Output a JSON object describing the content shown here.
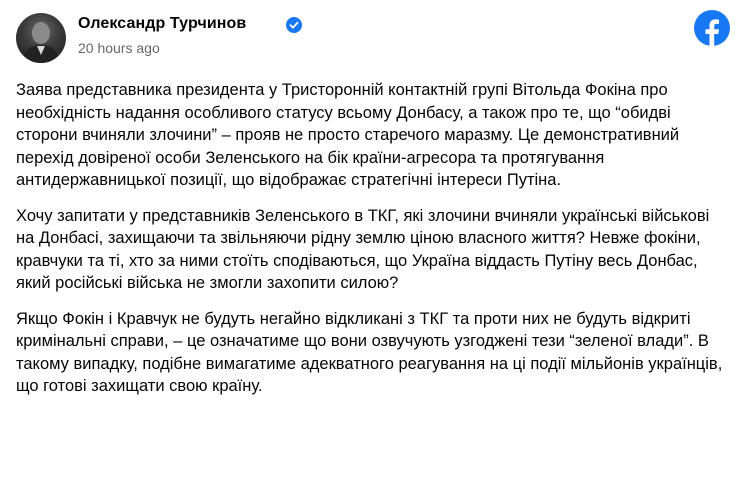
{
  "post": {
    "author": "Олександр Турчинов",
    "timestamp": "20 hours ago",
    "verified_icon": "verified-badge-icon",
    "platform_icon": "facebook-logo-icon",
    "colors": {
      "facebook_blue": "#1877f2",
      "timestamp_gray": "#65676b",
      "text": "#050505"
    },
    "paragraphs": [
      "Заява представника президента у Тристоронній контактній групі Вітольда Фокіна про необхідність надання особливого статусу всьому Донбасу, а також про те, що “обидві сторони вчиняли злочини” – прояв не просто старечого маразму. Це демонстративний перехід довіреної особи Зеленського на бік країни-агресора та протягування антидержавницької позиції, що відображає стратегічні інтереси Путіна.",
      "Хочу запитати у представників Зеленського в ТКГ, які злочини вчиняли українські військові на Донбасі, захищаючи та звільняючи рідну землю ціною власного життя? Невже фокіни, кравчуки та ті, хто за ними стоїть сподіваються, що Україна віддасть Путіну весь Донбас, який російські війська не змогли захопити силою?",
      "Якщо Фокін і Кравчук не будуть негайно відкликані з ТКГ та проти них не будуть відкриті кримінальні справи, – це означатиме що вони озвучують узгоджені тези “зеленої влади”. В такому випадку, подібне вимагатиме адекватного реагування на ці події мільйонів українців, що готові захищати свою країну."
    ]
  }
}
